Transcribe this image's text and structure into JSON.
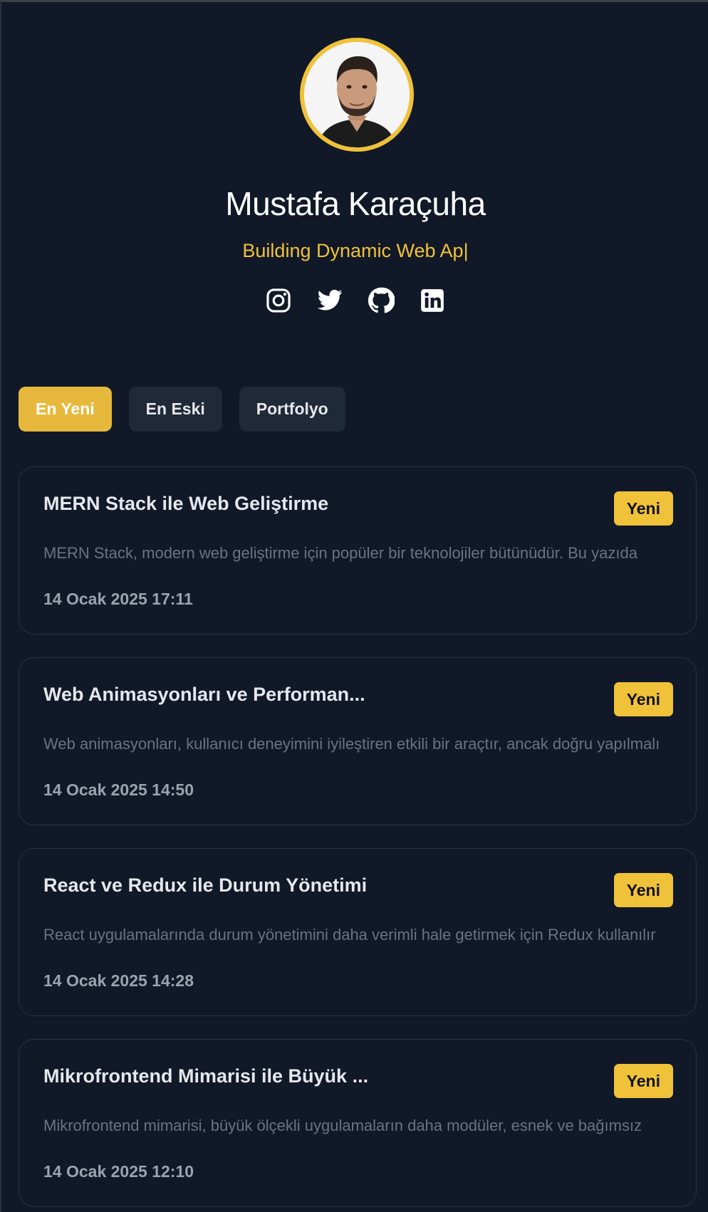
{
  "profile": {
    "name": "Mustafa Karaçuha",
    "tagline": "Building Dynamic Web Ap|",
    "accent_color": "#f0c23a",
    "socials": [
      {
        "icon": "instagram-icon"
      },
      {
        "icon": "twitter-icon"
      },
      {
        "icon": "github-icon"
      },
      {
        "icon": "linkedin-icon"
      }
    ]
  },
  "filters": [
    {
      "label": "En Yeni",
      "active": true
    },
    {
      "label": "En Eski",
      "active": false
    },
    {
      "label": "Portfolyo",
      "active": false
    }
  ],
  "posts": [
    {
      "title": "MERN Stack ile Web Geliştirme",
      "badge": "Yeni",
      "excerpt": "MERN Stack, modern web geliştirme için popüler bir teknolojiler bütünüdür. Bu yazıda",
      "date": "14 Ocak 2025 17:11"
    },
    {
      "title": "Web Animasyonları ve Performan...",
      "badge": "Yeni",
      "excerpt": "Web animasyonları, kullanıcı deneyimini iyileştiren etkili bir araçtır, ancak doğru yapılmalı",
      "date": "14 Ocak 2025 14:50"
    },
    {
      "title": "React ve Redux ile Durum Yönetimi",
      "badge": "Yeni",
      "excerpt": "React uygulamalarında durum yönetimini daha verimli hale getirmek için Redux kullanılır",
      "date": "14 Ocak 2025 14:28"
    },
    {
      "title": "Mikrofrontend Mimarisi ile Büyük ...",
      "badge": "Yeni",
      "excerpt": "Mikrofrontend mimarisi, büyük ölçekli uygulamaların daha modüler, esnek ve bağımsız",
      "date": "14 Ocak 2025 12:10"
    }
  ]
}
